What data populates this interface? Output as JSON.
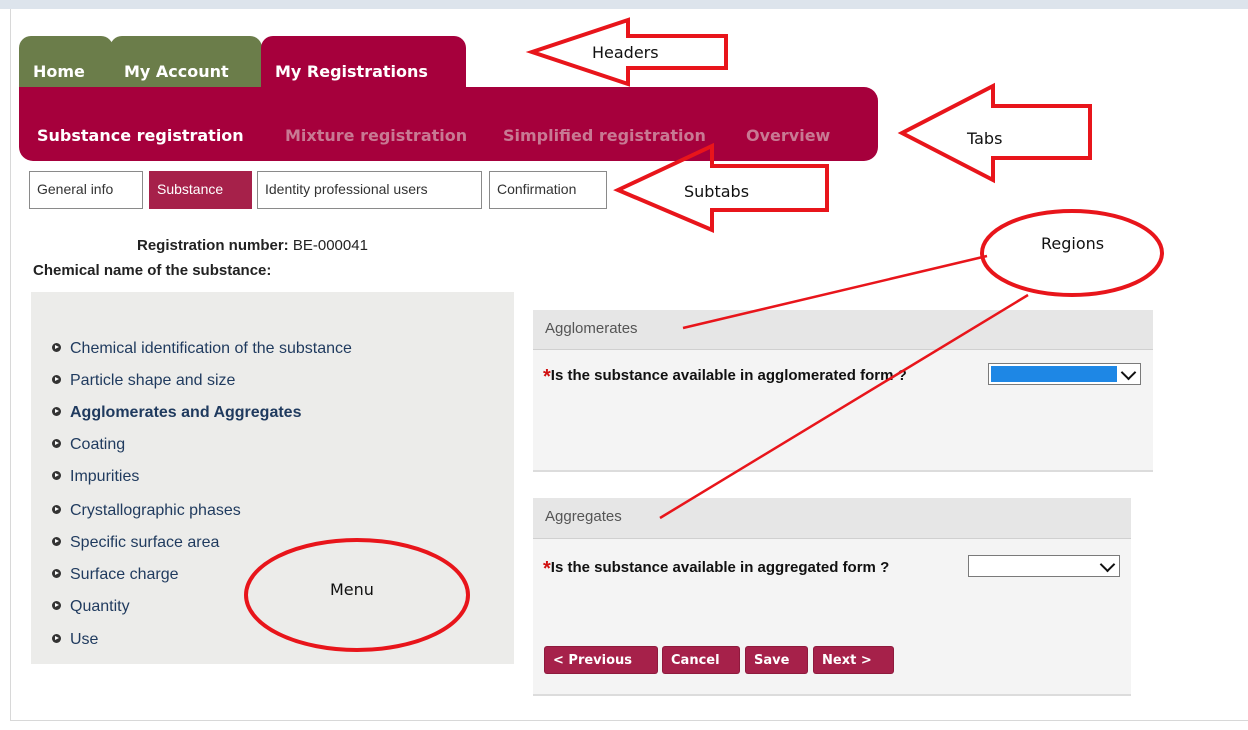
{
  "headers": [
    "Home",
    "My Account",
    "My Registrations"
  ],
  "tabs": [
    "Substance registration",
    "Mixture registration",
    "Simplified registration",
    "Overview"
  ],
  "subtabs": [
    "General info",
    "Substance",
    "Identity professional users",
    "Confirmation"
  ],
  "registration": {
    "number_label": "Registration number:",
    "number_value": "BE-000041",
    "chemical_name_label": "Chemical name of the substance:"
  },
  "menu": [
    "Chemical identification of the substance",
    "Particle shape and size",
    "Agglomerates and Aggregates",
    "Coating",
    "Impurities",
    "Crystallographic phases",
    "Specific surface area",
    "Surface charge",
    "Quantity",
    "Use"
  ],
  "agglomerates": {
    "title": "Agglomerates",
    "required_mark": "*",
    "question": "Is the substance available in agglomerated form ?"
  },
  "aggregates": {
    "title": "Aggregates",
    "required_mark": "*",
    "question": "Is the substance available in aggregated form ?"
  },
  "buttons": [
    "< Previous",
    "Cancel",
    "Save",
    "Next >"
  ],
  "annotations": {
    "headers": "Headers",
    "tabs": "Tabs",
    "subtabs": "Subtabs",
    "regions": "Regions",
    "menu": "Menu"
  },
  "colors": {
    "header_green": "#6b7d4a",
    "brand_crimson": "#a6003c",
    "tab_inactive": "#c87993",
    "button": "#a6214a",
    "annotation_red": "#e8151b",
    "select_highlight": "#1e87e5"
  },
  "icons": {
    "menu_bullet": "circle-arrow-right-icon",
    "dropdown": "chevron-down-icon",
    "required": "asterisk"
  }
}
